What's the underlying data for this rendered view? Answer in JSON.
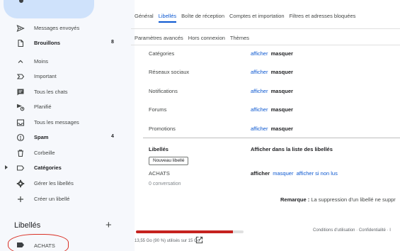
{
  "sidebar": {
    "items": [
      {
        "label": "Messages envoyés",
        "count": "",
        "icon": "send-icon",
        "bold": false
      },
      {
        "label": "Brouillons",
        "count": "8",
        "icon": "draft-icon",
        "bold": true
      },
      {
        "label": "Moins",
        "count": "",
        "icon": "chevron-up-icon",
        "bold": false
      },
      {
        "label": "Important",
        "count": "",
        "icon": "important-icon",
        "bold": false
      },
      {
        "label": "Tous les chats",
        "count": "",
        "icon": "chat-icon",
        "bold": false
      },
      {
        "label": "Planifié",
        "count": "",
        "icon": "scheduled-icon",
        "bold": false
      },
      {
        "label": "Tous les messages",
        "count": "",
        "icon": "all-mail-icon",
        "bold": false
      },
      {
        "label": "Spam",
        "count": "4",
        "icon": "spam-icon",
        "bold": true
      },
      {
        "label": "Corbeille",
        "count": "",
        "icon": "trash-icon",
        "bold": false
      },
      {
        "label": "Catégories",
        "count": "",
        "icon": "label-outline-icon",
        "bold": true
      },
      {
        "label": "Gérer les libellés",
        "count": "",
        "icon": "gear-icon",
        "bold": false
      },
      {
        "label": "Créer un libellé",
        "count": "",
        "icon": "plus-icon",
        "bold": false
      }
    ],
    "labels_heading": "Libellés",
    "labels_add": "+",
    "user_labels": [
      {
        "label": "ACHATS"
      }
    ]
  },
  "settings": {
    "tabs_row1": [
      "Général",
      "Libellés",
      "Boîte de réception",
      "Comptes et importation",
      "Filtres et adresses bloquées"
    ],
    "active_tab": "Libellés",
    "tabs_row2": [
      "Paramètres avancés",
      "Hors connexion",
      "Thèmes"
    ],
    "categories": [
      {
        "name": "Catégories",
        "show": "afficher",
        "hide": "masquer"
      },
      {
        "name": "Réseaux sociaux",
        "show": "afficher",
        "hide": "masquer"
      },
      {
        "name": "Notifications",
        "show": "afficher",
        "hide": "masquer"
      },
      {
        "name": "Forums",
        "show": "afficher",
        "hide": "masquer"
      },
      {
        "name": "Promotions",
        "show": "afficher",
        "hide": "masquer"
      }
    ],
    "labels_section": {
      "heading": "Libellés",
      "column_heading": "Afficher dans la liste des libellés",
      "new_label_button": "Nouveau libellé",
      "label_name": "ACHATS",
      "label_count": "0 conversation",
      "show": "afficher",
      "hide": "masquer",
      "show_if_unread": "afficher si non lus"
    },
    "note_bold": "Remarque :",
    "note_text": " La suppression d'un libellé ne suppr"
  },
  "footer": {
    "storage_text": "13,55 Go (90 %) utilisés sur 15 Go",
    "storage_fraction": 0.9,
    "links": "Conditions d'utilisation · Confidentialité · I"
  },
  "colors": {
    "accent": "#0b57d0",
    "storage": "#c5221f",
    "annotation": "#d93025"
  }
}
